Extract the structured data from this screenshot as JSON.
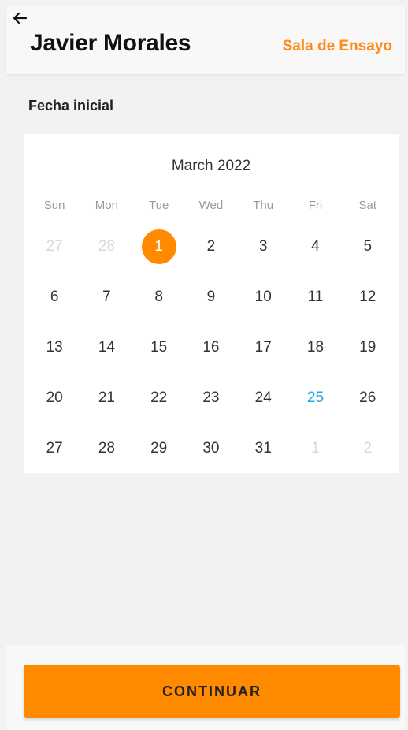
{
  "header": {
    "title": "Javier Morales",
    "subtitle": "Sala de Ensayo",
    "back_icon": "arrow-left-icon"
  },
  "section": {
    "label": "Fecha inicial"
  },
  "calendar": {
    "month_label": "March 2022",
    "days_of_week": [
      "Sun",
      "Mon",
      "Tue",
      "Wed",
      "Thu",
      "Fri",
      "Sat"
    ],
    "selected_day": "1",
    "today_day": "25",
    "accent_color": "#ff8a00",
    "today_color": "#1ea7e0",
    "weeks": [
      [
        {
          "d": "27",
          "m": true
        },
        {
          "d": "28",
          "m": true
        },
        {
          "d": "1",
          "s": true
        },
        {
          "d": "2"
        },
        {
          "d": "3"
        },
        {
          "d": "4"
        },
        {
          "d": "5"
        }
      ],
      [
        {
          "d": "6"
        },
        {
          "d": "7"
        },
        {
          "d": "8"
        },
        {
          "d": "9"
        },
        {
          "d": "10"
        },
        {
          "d": "11"
        },
        {
          "d": "12"
        }
      ],
      [
        {
          "d": "13"
        },
        {
          "d": "14"
        },
        {
          "d": "15"
        },
        {
          "d": "16"
        },
        {
          "d": "17"
        },
        {
          "d": "18"
        },
        {
          "d": "19"
        }
      ],
      [
        {
          "d": "20"
        },
        {
          "d": "21"
        },
        {
          "d": "22"
        },
        {
          "d": "23"
        },
        {
          "d": "24"
        },
        {
          "d": "25",
          "t": true
        },
        {
          "d": "26"
        }
      ],
      [
        {
          "d": "27"
        },
        {
          "d": "28"
        },
        {
          "d": "29"
        },
        {
          "d": "30"
        },
        {
          "d": "31"
        },
        {
          "d": "1",
          "m": true
        },
        {
          "d": "2",
          "m": true
        }
      ]
    ]
  },
  "footer": {
    "continue_label": "CONTINUAR"
  }
}
